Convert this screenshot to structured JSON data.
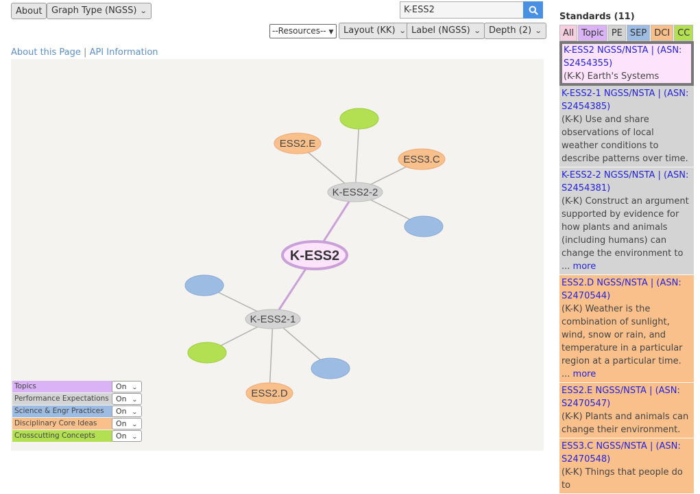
{
  "toolbar": {
    "about_label": "About",
    "graph_type_label": "Graph Type (NGSS)",
    "search_value": "K-ESS2",
    "resources_label": "--Resources--",
    "layout_label": "Layout (KK)",
    "label_label": "Label (NGSS)",
    "depth_label": "Depth (2)"
  },
  "links": {
    "about_page": "About this Page",
    "separator": "|",
    "api_info": "API Information"
  },
  "colors": {
    "topic": "#d9b3f5",
    "pe": "#d4d4d4",
    "sep": "#9dbce3",
    "dci": "#f9c08c",
    "cc": "#b3e052",
    "all": "#f7cde0",
    "selected_card": "#fde3fb",
    "accent": "#4a90e2"
  },
  "graph": {
    "nodes": [
      {
        "id": "root",
        "label": "K-ESS2",
        "type": "topic",
        "root": true
      },
      {
        "id": "pe2",
        "label": "K-ESS2-2",
        "type": "pe"
      },
      {
        "id": "pe1",
        "label": "K-ESS2-1",
        "type": "pe"
      },
      {
        "id": "ess2e",
        "label": "ESS2.E",
        "type": "dci"
      },
      {
        "id": "ess3c",
        "label": "ESS3.C",
        "type": "dci"
      },
      {
        "id": "cc1",
        "label": "",
        "type": "cc"
      },
      {
        "id": "sep1",
        "label": "",
        "type": "sep"
      },
      {
        "id": "sep2",
        "label": "",
        "type": "sep"
      },
      {
        "id": "cc2",
        "label": "",
        "type": "cc"
      },
      {
        "id": "sep3",
        "label": "",
        "type": "sep"
      },
      {
        "id": "ess2d",
        "label": "ESS2.D",
        "type": "dci"
      }
    ],
    "edges": [
      [
        "root",
        "pe2"
      ],
      [
        "root",
        "pe1"
      ],
      [
        "pe2",
        "ess2e"
      ],
      [
        "pe2",
        "cc1"
      ],
      [
        "pe2",
        "ess3c"
      ],
      [
        "pe2",
        "sep1"
      ],
      [
        "pe1",
        "sep2"
      ],
      [
        "pe1",
        "cc2"
      ],
      [
        "pe1",
        "ess2d"
      ],
      [
        "pe1",
        "sep3"
      ]
    ]
  },
  "legend": [
    {
      "label": "Topics",
      "type": "topic",
      "value": "On"
    },
    {
      "label": "Performance Expectations",
      "type": "pe",
      "value": "On"
    },
    {
      "label": "Science & Engr Practices",
      "type": "sep",
      "value": "On"
    },
    {
      "label": "Disciplinary Core Ideas",
      "type": "dci",
      "value": "On"
    },
    {
      "label": "Crosscutting Concepts",
      "type": "cc",
      "value": "On"
    }
  ],
  "panel": {
    "title": "Standards (11)",
    "tabs": [
      {
        "label": "All",
        "type": "all"
      },
      {
        "label": "Topic",
        "type": "topic"
      },
      {
        "label": "PE",
        "type": "pe"
      },
      {
        "label": "SEP",
        "type": "sep"
      },
      {
        "label": "DCI",
        "type": "dci"
      },
      {
        "label": "CC",
        "type": "cc"
      }
    ],
    "cards": [
      {
        "title": "K-ESS2 NGSS/NSTA  |  (ASN: S2454355)",
        "desc": "(K-K) Earth's Systems",
        "more": "",
        "type": "selected"
      },
      {
        "title": "K-ESS2-1 NGSS/NSTA  |  (ASN: S2454385)",
        "desc": "(K-K) Use and share observations of local weather conditions to describe patterns over time.",
        "more": "",
        "type": "pe"
      },
      {
        "title": "K-ESS2-2 NGSS/NSTA  |  (ASN: S2454381)",
        "desc": "(K-K) Construct an argument supported by evidence for how plants and animals (including humans) can change the environment to ...",
        "more": "more",
        "type": "pe"
      },
      {
        "title": "ESS2.D NGSS/NSTA  |  (ASN: S2470544)",
        "desc": "(K-K) Weather is the combination of sunlight, wind, snow or rain, and temperature in a particular region at a particular time. ...",
        "more": "more",
        "type": "dci"
      },
      {
        "title": "ESS2.E NGSS/NSTA  |  (ASN: S2470547)",
        "desc": "(K-K) Plants and animals can change their environment.",
        "more": "",
        "type": "dci"
      },
      {
        "title": "ESS3.C NGSS/NSTA  |  (ASN: S2470548)",
        "desc": "(K-K) Things that people do to",
        "more": "",
        "type": "dci"
      }
    ]
  }
}
